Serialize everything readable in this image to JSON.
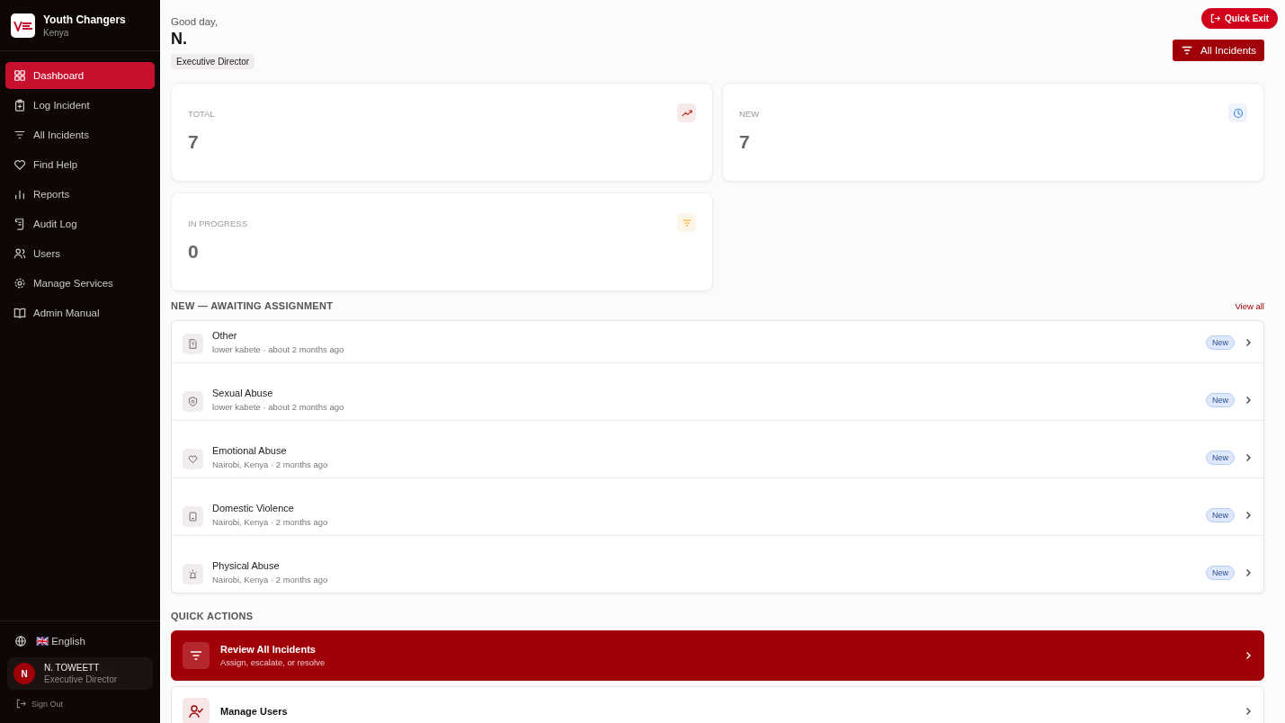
{
  "org": {
    "name": "Youth Changers",
    "country": "Kenya"
  },
  "nav": [
    {
      "label": "Dashboard",
      "kind": "grid",
      "selected": true
    },
    {
      "label": "Log Incident",
      "kind": "clipboard",
      "selected": false
    },
    {
      "label": "All Incidents",
      "kind": "filter",
      "selected": false
    },
    {
      "label": "Find Help",
      "kind": "heart",
      "selected": false
    },
    {
      "label": "Reports",
      "kind": "bars",
      "selected": false
    },
    {
      "label": "Audit Log",
      "kind": "scroll",
      "selected": false
    },
    {
      "label": "Users",
      "kind": "users",
      "selected": false
    },
    {
      "label": "Manage Services",
      "kind": "gear",
      "selected": false
    },
    {
      "label": "Admin Manual",
      "kind": "book",
      "selected": false
    }
  ],
  "language": {
    "flag": "🇬🇧",
    "label": "English"
  },
  "user": {
    "initial": "N",
    "name": "N. TOWEETT",
    "role": "Executive Director"
  },
  "sign_out": "Sign Out",
  "greeting": "Good day,",
  "name": "N.",
  "role_badge": "Executive Director",
  "header_button": "All Incidents",
  "quick_exit": "Quick Exit",
  "stats": [
    {
      "label": "TOTAL",
      "value": "7",
      "kind": "trend"
    },
    {
      "label": "NEW",
      "value": "7",
      "kind": "clock"
    },
    {
      "label": "IN PROGRESS",
      "value": "0",
      "kind": "filter"
    }
  ],
  "new_section": {
    "title": "NEW — AWAITING ASSIGNMENT",
    "link": "View all"
  },
  "incidents": [
    {
      "title": "Other",
      "meta": "lower kabete · about 2 months ago",
      "badge": "New",
      "kind": "question"
    },
    {
      "title": "Sexual Abuse",
      "meta": "lower kabete · about 2 months ago",
      "badge": "New",
      "kind": "shield"
    },
    {
      "title": "Emotional Abuse",
      "meta": "Nairobi, Kenya · 2 months ago",
      "badge": "New",
      "kind": "heart"
    },
    {
      "title": "Domestic Violence",
      "meta": "Nairobi, Kenya · 2 months ago",
      "badge": "New",
      "kind": "home"
    },
    {
      "title": "Physical Abuse",
      "meta": "Nairobi, Kenya · 2 months ago",
      "badge": "New",
      "kind": "alert"
    }
  ],
  "quick_actions": {
    "title": "QUICK ACTIONS",
    "items": [
      {
        "title": "Review All Incidents",
        "subtitle": "Assign, escalate, or resolve",
        "kind": "filter",
        "selected": true
      },
      {
        "title": "Manage Users",
        "kind": "user",
        "selected": false
      }
    ]
  }
}
